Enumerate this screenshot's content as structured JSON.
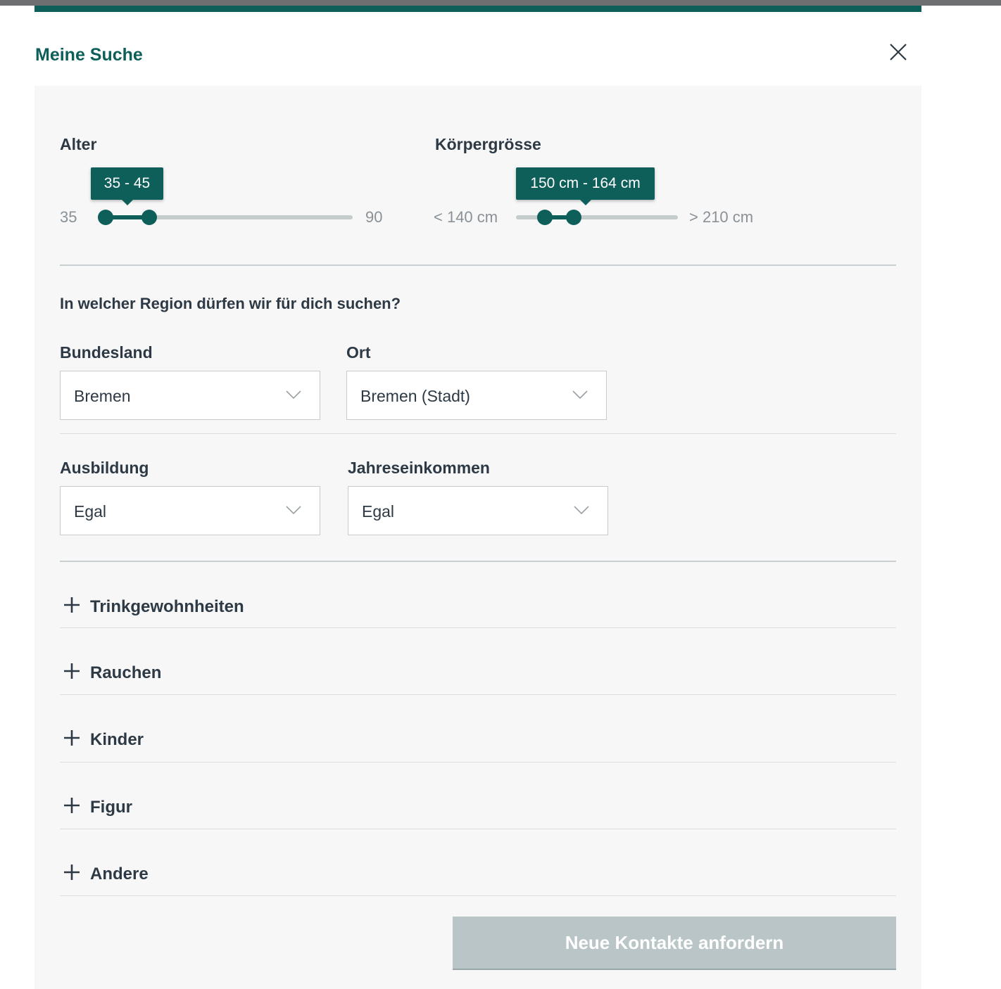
{
  "modal": {
    "title": "Meine Suche"
  },
  "age": {
    "label": "Alter",
    "min_label": "35",
    "max_label": "90",
    "selected_display": "35 - 45",
    "min": 35,
    "max": 90,
    "selected_from": 35,
    "selected_to": 45
  },
  "height": {
    "label": "Körpergrösse",
    "min_label": "< 140 cm",
    "max_label": "> 210 cm",
    "selected_display": "150 cm - 164 cm",
    "min": 140,
    "max": 210,
    "selected_from": 150,
    "selected_to": 164
  },
  "region": {
    "question": "In welcher Region dürfen wir für dich suchen?",
    "bundesland": {
      "label": "Bundesland",
      "value": "Bremen"
    },
    "ort": {
      "label": "Ort",
      "value": "Bremen (Stadt)"
    }
  },
  "education": {
    "label": "Ausbildung",
    "value": "Egal"
  },
  "income": {
    "label": "Jahreseinkommen",
    "value": "Egal"
  },
  "accordions": [
    "Trinkgewohnheiten",
    "Rauchen",
    "Kinder",
    "Figur",
    "Andere"
  ],
  "submit_label": "Neue Kontakte anfordern",
  "colors": {
    "accent": "#0e5e5a",
    "panel_bg": "#f7f7f7",
    "button_disabled": "#b9c5c6",
    "slider_track": "#c4cccc"
  },
  "icons": {
    "close": "close-icon",
    "select": "chevron-down-icon",
    "accordion": "plus-icon"
  }
}
